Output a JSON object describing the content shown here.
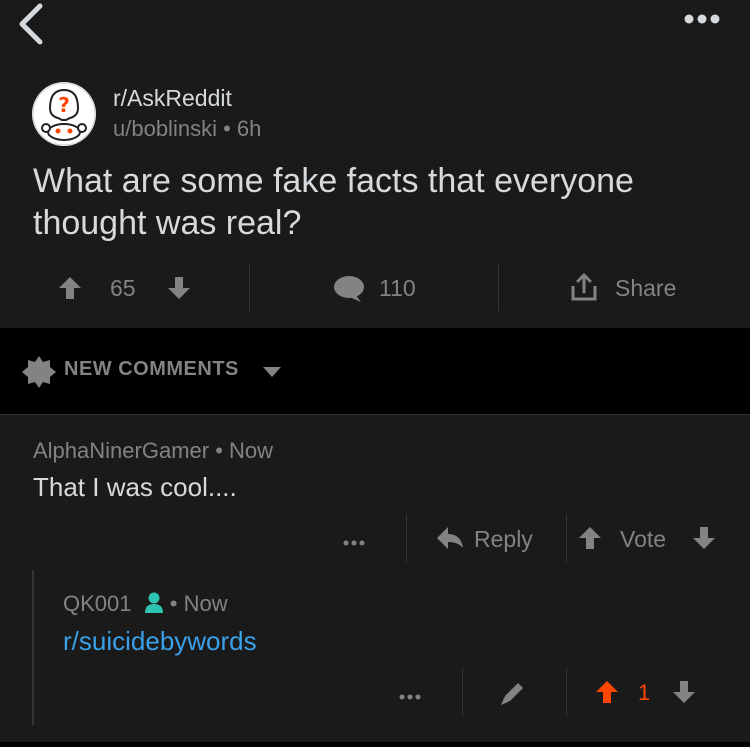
{
  "post": {
    "subreddit": "r/AskReddit",
    "author": "u/boblinski",
    "age": "6h",
    "title": "What are some fake facts that everyone thought was real?",
    "score": "65",
    "comments_count": "110",
    "share_label": "Share"
  },
  "sort": {
    "label": "NEW COMMENTS"
  },
  "comments": [
    {
      "author": "AlphaNinerGamer",
      "age": "Now",
      "body": "That I was cool....",
      "reply_label": "Reply",
      "vote_label": "Vote"
    },
    {
      "author": "QK001",
      "age": "Now",
      "body": "r/suicidebywords",
      "score": "1"
    }
  ],
  "colors": {
    "background": "#1a1a1b",
    "band": "#000000",
    "text": "#d7dadc",
    "muted": "#818384",
    "link": "#3aa0e8",
    "upvote_active": "#ff4500",
    "user_badge": "#2dc4b1"
  },
  "icons": [
    "back-arrow-icon",
    "more-options-icon",
    "snoo-question-avatar",
    "upvote-icon",
    "downvote-icon",
    "comment-bubble-icon",
    "share-icon",
    "sort-gear-icon",
    "chevron-down-icon",
    "reply-arrow-icon",
    "user-badge-icon",
    "edit-pencil-icon"
  ]
}
